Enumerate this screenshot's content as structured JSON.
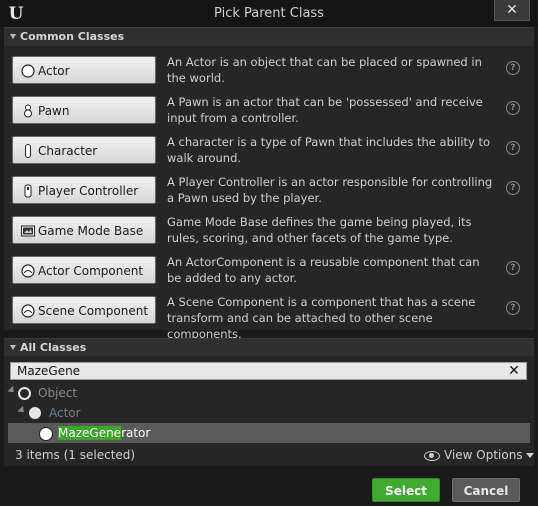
{
  "window": {
    "title": "Pick Parent Class",
    "logo": "U",
    "close_label": "✕"
  },
  "common": {
    "header": "Common Classes",
    "items": [
      {
        "label": "Actor",
        "icon": "sphere-icon",
        "desc": "An Actor is an object that can be placed or spawned in the world."
      },
      {
        "label": "Pawn",
        "icon": "pawn-icon",
        "desc": "A Pawn is an actor that can be 'possessed' and receive input from a controller."
      },
      {
        "label": "Character",
        "icon": "character-icon",
        "desc": "A character is a type of Pawn that includes the ability to walk around."
      },
      {
        "label": "Player Controller",
        "icon": "controller-icon",
        "desc": "A Player Controller is an actor responsible for controlling a Pawn used by the player."
      },
      {
        "label": "Game Mode Base",
        "icon": "game-mode-icon",
        "desc": "Game Mode Base defines the game being played, its rules, scoring, and other facets of the game type."
      },
      {
        "label": "Actor Component",
        "icon": "component-icon",
        "desc": "An ActorComponent is a reusable component that can be added to any actor."
      },
      {
        "label": "Scene Component",
        "icon": "scene-component-icon",
        "desc": "A Scene Component is a component that has a scene transform and can be attached to other scene components."
      }
    ],
    "help_glyph": "?"
  },
  "all": {
    "header": "All Classes",
    "search_value": "MazeGene",
    "clear_glyph": "✕",
    "tree": [
      {
        "label": "Object",
        "color": "#8a8a8a"
      },
      {
        "label": "Actor",
        "color": "#6f7f8c"
      },
      {
        "match": "MazeGene",
        "rest": "rator",
        "color": "#ffffff"
      }
    ],
    "status": "3 items (1 selected)",
    "view_options": "View Options"
  },
  "footer": {
    "select_label": "Select",
    "cancel_label": "Cancel"
  },
  "colors": {
    "accent_green": "#3fab2f",
    "highlight_green": "#3da52a"
  }
}
